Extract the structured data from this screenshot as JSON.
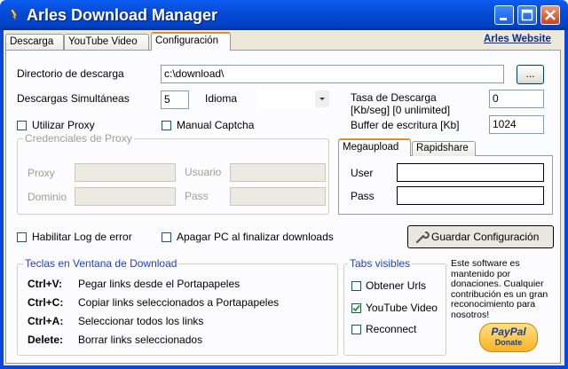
{
  "window": {
    "title": "Arles Download Manager"
  },
  "tabs": [
    {
      "label": "Descarga"
    },
    {
      "label": "YouTube Video"
    },
    {
      "label": "Configuración"
    }
  ],
  "header_link": "Arles Website",
  "config": {
    "download_dir_label": "Directorio de descarga",
    "download_dir_value": "c:\\download\\",
    "browse_label": "...",
    "simultaneous_label": "Descargas Simultáneas",
    "simultaneous_value": "5",
    "language_label": "Idioma",
    "language_value": "",
    "rate_label_1": "Tasa de Descarga",
    "rate_label_2": "[Kb/seg] [0 unlimited]",
    "rate_value": "0",
    "buffer_label": "Buffer de escritura [Kb]",
    "buffer_value": "1024",
    "use_proxy_label": "Utilizar Proxy",
    "manual_captcha_label": "Manual Captcha"
  },
  "proxy": {
    "title": "Credenciales de Proxy",
    "proxy_label": "Proxy",
    "user_label": "Usuario",
    "domain_label": "Dominio",
    "pass_label": "Pass"
  },
  "accounts": {
    "tabs": [
      "Megaupload",
      "Rapidshare"
    ],
    "user_label": "User",
    "pass_label": "Pass"
  },
  "options": {
    "log_label": "Habilitar Log de error",
    "shutdown_label": "Apagar PC al finalizar downloads",
    "save_label": "Guardar Configuración"
  },
  "shortcuts": {
    "title": "Teclas en Ventana de Download",
    "rows": [
      {
        "key": "Ctrl+V:",
        "desc": "Pegar links desde el Portapapeles"
      },
      {
        "key": "Ctrl+C:",
        "desc": "Copiar links seleccionados a Portapapeles"
      },
      {
        "key": "Ctrl+A:",
        "desc": "Seleccionar todos los links"
      },
      {
        "key": "Delete:",
        "desc": "Borrar links seleccionados"
      }
    ]
  },
  "visible_tabs": {
    "title": "Tabs visibles",
    "items": [
      {
        "label": "Obtener Urls",
        "checked": false
      },
      {
        "label": "YouTube Video",
        "checked": true
      },
      {
        "label": "Reconnect",
        "checked": false
      }
    ]
  },
  "donation": {
    "text": "Este software es mantenido por donaciones. Cualquier contribución es un gran reconocimiento para nosotros!",
    "paypal_label": "PayPal",
    "donate_label": "Donate"
  },
  "colors": {
    "titlebar": "#0447d0",
    "accent_tab": "#e68b2c",
    "panel_bg": "#fcfcfe",
    "group_title": "#1a3fd0"
  }
}
